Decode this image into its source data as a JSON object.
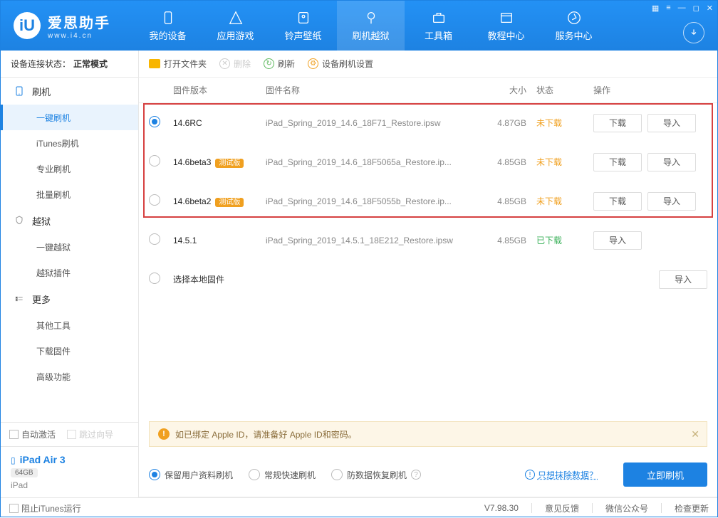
{
  "header": {
    "title": "爱思助手",
    "url": "www.i4.cn",
    "nav": [
      "我的设备",
      "应用游戏",
      "铃声壁纸",
      "刷机越狱",
      "工具箱",
      "教程中心",
      "服务中心"
    ],
    "nav_active": 3
  },
  "sidebar": {
    "status_label": "设备连接状态：",
    "status_value": "正常模式",
    "groups": [
      {
        "label": "刷机",
        "subs": [
          "一键刷机",
          "iTunes刷机",
          "专业刷机",
          "批量刷机"
        ],
        "active": 0
      },
      {
        "label": "越狱",
        "subs": [
          "一键越狱",
          "越狱插件"
        ]
      },
      {
        "label": "更多",
        "subs": [
          "其他工具",
          "下载固件",
          "高级功能"
        ]
      }
    ],
    "auto_activate": "自动激活",
    "skip_guide": "跳过向导",
    "device": {
      "name": "iPad Air 3",
      "storage": "64GB",
      "type": "iPad"
    }
  },
  "toolbar": {
    "open": "打开文件夹",
    "delete": "删除",
    "refresh": "刷新",
    "settings": "设备刷机设置"
  },
  "columns": {
    "ver": "固件版本",
    "name": "固件名称",
    "size": "大小",
    "status": "状态",
    "ops": "操作"
  },
  "firmware": [
    {
      "ver": "14.6RC",
      "beta": false,
      "name": "iPad_Spring_2019_14.6_18F71_Restore.ipsw",
      "size": "4.87GB",
      "status": "未下载",
      "status_cls": "not",
      "selected": true,
      "dl": true
    },
    {
      "ver": "14.6beta3",
      "beta": true,
      "name": "iPad_Spring_2019_14.6_18F5065a_Restore.ip...",
      "size": "4.85GB",
      "status": "未下载",
      "status_cls": "not",
      "selected": false,
      "dl": true
    },
    {
      "ver": "14.6beta2",
      "beta": true,
      "name": "iPad_Spring_2019_14.6_18F5055b_Restore.ip...",
      "size": "4.85GB",
      "status": "未下载",
      "status_cls": "not",
      "selected": false,
      "dl": true
    },
    {
      "ver": "14.5.1",
      "beta": false,
      "name": "iPad_Spring_2019_14.5.1_18E212_Restore.ipsw",
      "size": "4.85GB",
      "status": "已下载",
      "status_cls": "done",
      "selected": false,
      "dl": false
    }
  ],
  "local_row": "选择本地固件",
  "beta_badge": "测试版",
  "btn": {
    "download": "下载",
    "import": "导入"
  },
  "tip": "如已绑定 Apple ID，请准备好 Apple ID和密码。",
  "modes": {
    "keep": "保留用户资料刷机",
    "fast": "常规快速刷机",
    "anti": "防数据恢复刷机",
    "erase": "只想抹除数据？",
    "flash": "立即刷机"
  },
  "footer": {
    "block": "阻止iTunes运行",
    "version": "V7.98.30",
    "feedback": "意见反馈",
    "wechat": "微信公众号",
    "update": "检查更新"
  }
}
